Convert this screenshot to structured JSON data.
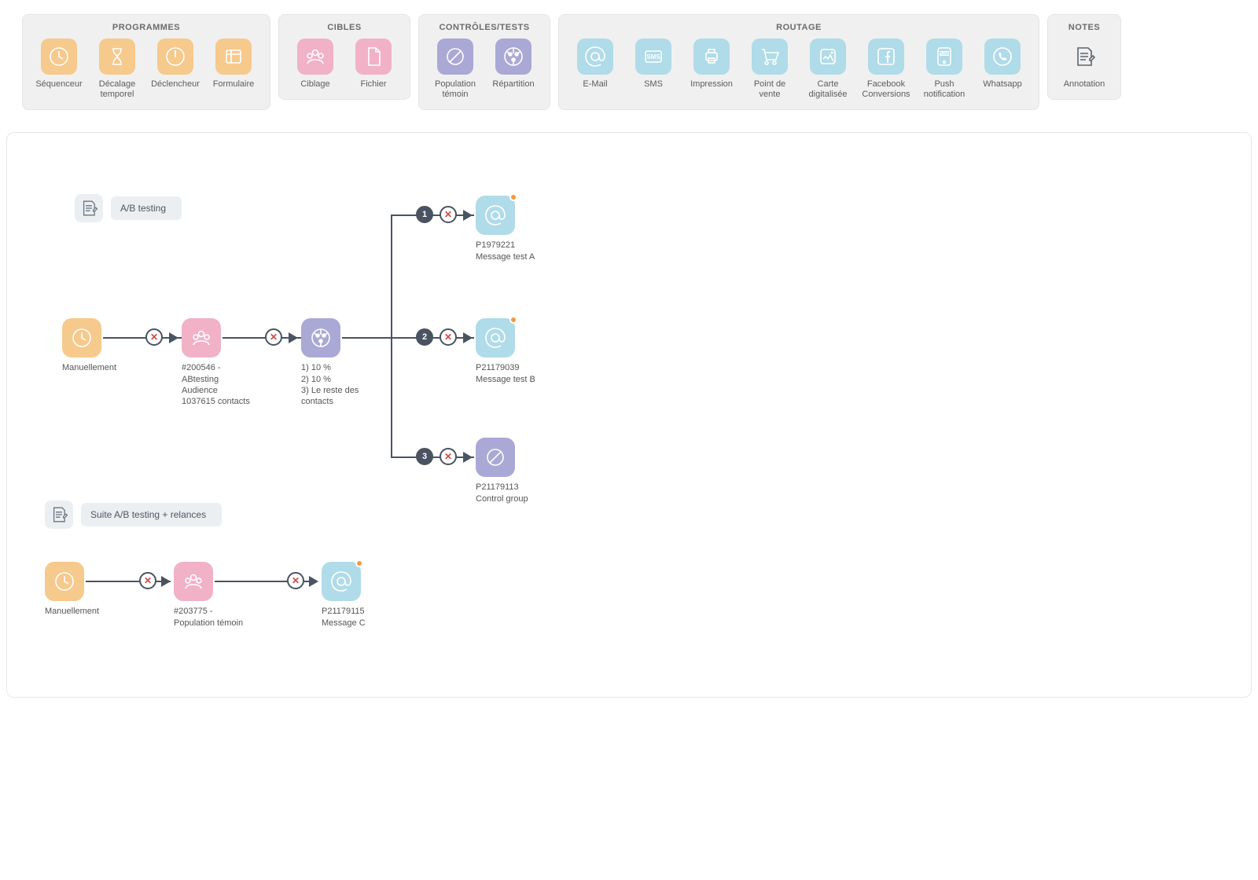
{
  "toolbar": {
    "groups": [
      {
        "title": "PROGRAMMES",
        "items": [
          {
            "name": "sequencer",
            "label": "Séquenceur",
            "color": "c-orange",
            "icon": "clock"
          },
          {
            "name": "time-offset",
            "label": "Décalage temporel",
            "color": "c-orange",
            "icon": "hourglass"
          },
          {
            "name": "trigger",
            "label": "Déclencheur",
            "color": "c-orange",
            "icon": "power"
          },
          {
            "name": "form",
            "label": "Formulaire",
            "color": "c-orange",
            "icon": "form"
          }
        ]
      },
      {
        "title": "CIBLES",
        "items": [
          {
            "name": "targeting",
            "label": "Ciblage",
            "color": "c-pink",
            "icon": "people"
          },
          {
            "name": "file",
            "label": "Fichier",
            "color": "c-pink",
            "icon": "file"
          }
        ]
      },
      {
        "title": "CONTRÔLES/TESTS",
        "items": [
          {
            "name": "control-pop",
            "label": "Population témoin",
            "color": "c-purple",
            "icon": "slash-circle"
          },
          {
            "name": "split",
            "label": "Répartition",
            "color": "c-purple",
            "icon": "split"
          }
        ]
      },
      {
        "title": "ROUTAGE",
        "items": [
          {
            "name": "email",
            "label": "E-Mail",
            "color": "c-blue",
            "icon": "at"
          },
          {
            "name": "sms",
            "label": "SMS",
            "color": "c-blue",
            "icon": "sms"
          },
          {
            "name": "print",
            "label": "Impression",
            "color": "c-blue",
            "icon": "print"
          },
          {
            "name": "pos",
            "label": "Point de vente",
            "color": "c-blue",
            "icon": "cart"
          },
          {
            "name": "digitized-card",
            "label": "Carte digitalisée",
            "color": "c-blue",
            "icon": "card"
          },
          {
            "name": "facebook",
            "label": "Facebook Conversions",
            "color": "c-blue",
            "icon": "facebook"
          },
          {
            "name": "push",
            "label": "Push notification",
            "color": "c-blue",
            "icon": "push"
          },
          {
            "name": "whatsapp",
            "label": "Whatsapp",
            "color": "c-blue",
            "icon": "whatsapp"
          }
        ]
      },
      {
        "title": "NOTES",
        "items": [
          {
            "name": "annotation",
            "label": "Annotation",
            "color": "",
            "icon": "note-dark"
          }
        ]
      }
    ]
  },
  "sections": {
    "ab": {
      "title": "A/B testing"
    },
    "suite": {
      "title": "Suite A/B testing + relances"
    }
  },
  "nodes": {
    "start1": {
      "label": "Manuellement"
    },
    "targeting1": {
      "line1": "#200546 -",
      "line2": "ABtesting",
      "line3": "Audience",
      "line4": "1037615 contacts"
    },
    "split1": {
      "line1": "1) 10 %",
      "line2": "2) 10 %",
      "line3": "3) Le reste des",
      "line4": "contacts"
    },
    "emailA": {
      "line1": "P1979221",
      "line2": "Message test A"
    },
    "emailB": {
      "line1": "P21179039",
      "line2": "Message test B"
    },
    "control": {
      "line1": "P21179113",
      "line2": "Control group"
    },
    "start2": {
      "label": "Manuellement"
    },
    "targeting2": {
      "line1": "#203775 -",
      "line2": "Population témoin"
    },
    "emailC": {
      "line1": "P21179115",
      "line2": "Message C"
    }
  },
  "branchNumbers": {
    "a": "1",
    "b": "2",
    "c": "3"
  },
  "markerSymbol": "✕",
  "colors": {
    "nodeOrange": "#f6c98d",
    "nodePink": "#f1b1c6",
    "nodePurple": "#aaa8d5",
    "nodeBlue": "#b0dbe9"
  }
}
